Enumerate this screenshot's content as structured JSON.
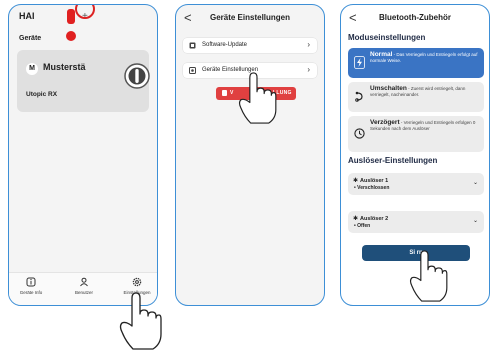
{
  "screen1": {
    "title": "HAI",
    "back_label": "<",
    "plus_label": "+",
    "section_label": "Geräte",
    "device": {
      "badge": "M",
      "name": "Musterstä",
      "model": "Utopic RX"
    },
    "tabs": [
      {
        "label": "Geräte Info"
      },
      {
        "label": "Benutzer"
      },
      {
        "label": "Einstellungen"
      }
    ]
  },
  "screen2": {
    "back_label": "<",
    "title": "Geräte Einstellungen",
    "items": [
      {
        "label": "Software-Update"
      },
      {
        "label": "Geräte Einstellungen"
      }
    ],
    "button_left": "V",
    "button_right": "LLUNG"
  },
  "screen3": {
    "back_label": "<",
    "title": "Bluetooth-Zubehör",
    "modes_heading": "Moduseinstellungen",
    "modes": [
      {
        "name": "Normal",
        "desc": " - Das Verriegeln und Entriegeln erfolgt auf normale Weise."
      },
      {
        "name": "Umschalten",
        "desc": " - Zuerst wird entriegelt, dann verriegelt, nacheinander."
      },
      {
        "name": "Verzögert",
        "desc": " - Verriegeln und Entriegeln erfolgen 0 Sekunden nach dem Auslöser"
      }
    ],
    "triggers_heading": "Auslöser-Einstellungen",
    "triggers": [
      {
        "name": "Auslöser 1",
        "state": "• Verschlossen"
      },
      {
        "name": "Auslöser 2",
        "state": "• Offen"
      }
    ],
    "save_label": "Si   rn"
  },
  "colors": {
    "frame": "#3d8fd6",
    "alert_red": "#e02020",
    "selected_mode": "#3a74c4",
    "save_button": "#1f4f7a",
    "red_button": "#e04040"
  },
  "icons": [
    "shield-lock-icon",
    "info-icon",
    "user-icon",
    "gear-icon",
    "refresh-icon",
    "settings-icon",
    "bolt-icon",
    "toggle-icon",
    "clock-icon",
    "hand-pointer-icon"
  ]
}
